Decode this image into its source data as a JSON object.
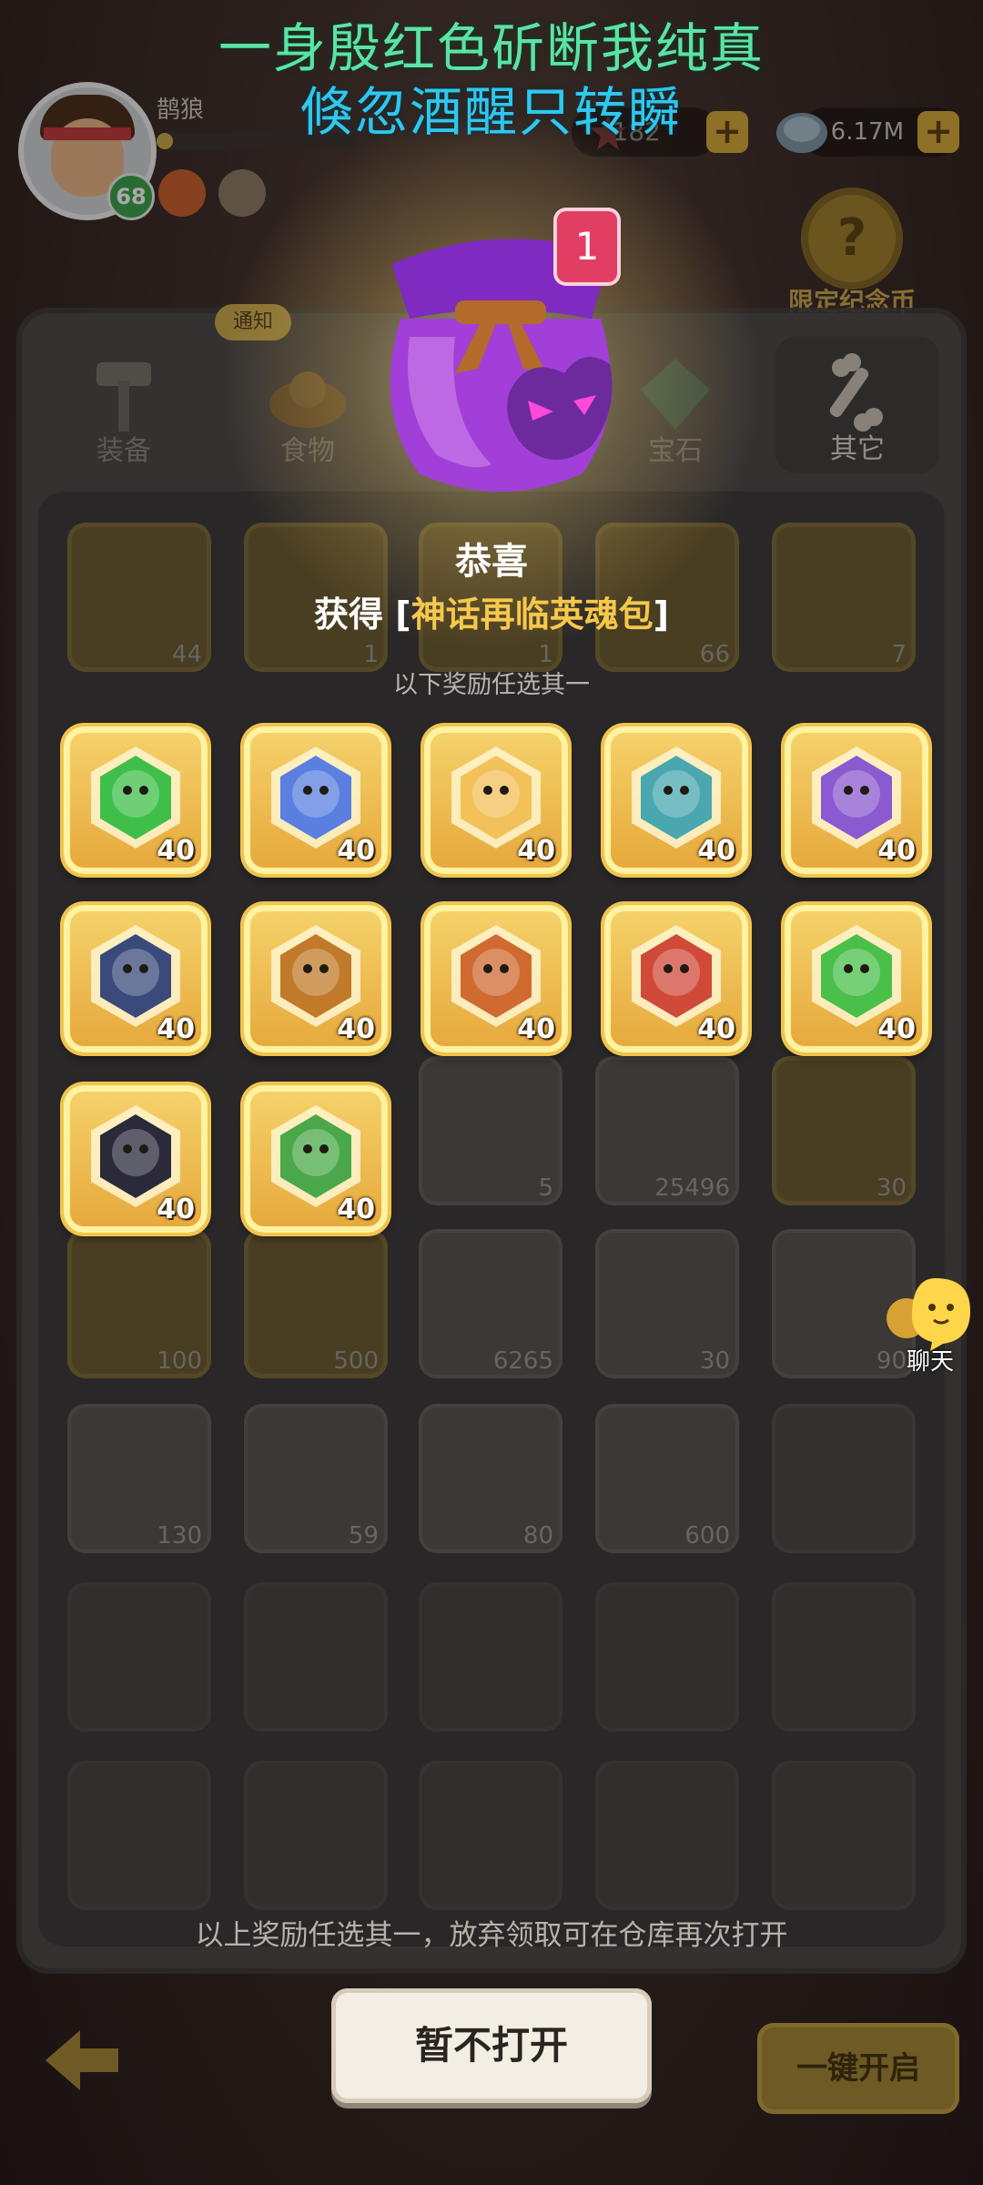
{
  "lyrics": {
    "line1": "一身殷红色斫断我纯真",
    "line2": "倏忽酒醒只转瞬"
  },
  "header": {
    "player_name": "鹊狼",
    "level": "68",
    "exp_progress": 0.08,
    "currency1_value": "182",
    "currency2_value": "6.17M",
    "plus_label": "+",
    "event_coin_label": "限定纪念币",
    "event_coin_glyph": "?",
    "notice_tag": "通知"
  },
  "tabs": [
    {
      "label": "装备"
    },
    {
      "label": "食物"
    },
    {
      "label": "宝石"
    },
    {
      "label": "其它"
    }
  ],
  "background_counts": [
    "44",
    "1",
    "1",
    "66",
    "7",
    "5",
    "25496",
    "30",
    "100",
    "500",
    "6265",
    "30",
    "90",
    "130",
    "59",
    "80",
    "600"
  ],
  "popup": {
    "badge_count": "1",
    "title": "恭喜",
    "got_prefix": "获得 [",
    "got_item": "神话再临英魂包",
    "got_suffix": "]",
    "subtitle": "以下奖励任选其一",
    "rewards": [
      {
        "icon": "green-dragon-soul-icon",
        "count": "40",
        "color": "#3fbf4a"
      },
      {
        "icon": "blue-hair-hero-soul-icon",
        "count": "40",
        "color": "#5a7fe0"
      },
      {
        "icon": "golden-sun-soul-icon",
        "count": "40",
        "color": "#f2c15a"
      },
      {
        "icon": "armored-mech-soul-icon",
        "count": "40",
        "color": "#4aa7b0"
      },
      {
        "icon": "purple-hair-hero-soul-icon",
        "count": "40",
        "color": "#8a5ad0"
      },
      {
        "icon": "dark-wolf-soul-icon",
        "count": "40",
        "color": "#3a4a7a"
      },
      {
        "icon": "bronze-robot-soul-icon",
        "count": "40",
        "color": "#c07a2a"
      },
      {
        "icon": "fox-creature-soul-icon",
        "count": "40",
        "color": "#d06a30"
      },
      {
        "icon": "red-blade-soul-icon",
        "count": "40",
        "color": "#d04a3a"
      },
      {
        "icon": "green-leaf-soul-icon",
        "count": "40",
        "color": "#4ac04a"
      },
      {
        "icon": "penguin-bird-soul-icon",
        "count": "40",
        "color": "#2a2a3a"
      },
      {
        "icon": "green-cactus-soul-icon",
        "count": "40",
        "color": "#4aa84a"
      }
    ]
  },
  "footer": {
    "note": "以上奖励任选其一，放弃领取可在仓库再次打开",
    "skip_label": "暂不打开",
    "open_all_label": "一键开启",
    "chat_label": "聊天"
  }
}
